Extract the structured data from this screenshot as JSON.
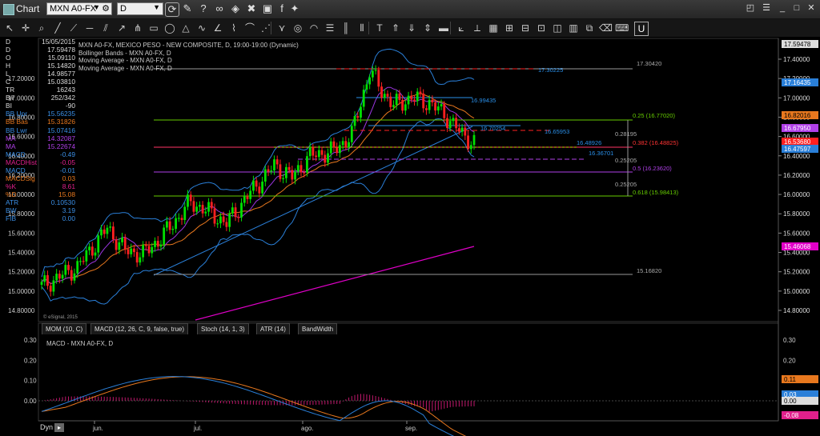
{
  "window": {
    "title": "Chart",
    "symbol": "MXN A0-FX",
    "interval": "D"
  },
  "colors": {
    "up": "#00e000",
    "down": "#ff2020",
    "bb": "#2a7fd8",
    "ma_orange": "#e8781e",
    "ma_purple": "#9b35e0",
    "ma_magenta": "#e000c8",
    "fib": "#66cc00"
  },
  "data_window": [
    {
      "label": "D",
      "value": "15/05/2015",
      "color": "#dddddd"
    },
    {
      "label": "D",
      "value": "17.59478",
      "color": "#dddddd"
    },
    {
      "label": "O",
      "value": "15.09110",
      "color": "#dddddd"
    },
    {
      "label": "H",
      "value": "15.14820",
      "color": "#dddddd"
    },
    {
      "label": "L",
      "value": "14.98577",
      "color": "#dddddd"
    },
    {
      "label": "C",
      "value": "15.03810",
      "color": "#dddddd"
    },
    {
      "label": "TR",
      "value": "16243",
      "color": "#dddddd"
    },
    {
      "label": "B#",
      "value": "252/342",
      "color": "#dddddd"
    },
    {
      "label": "BI",
      "value": "-90",
      "color": "#dddddd"
    },
    {
      "label": "BB Upr",
      "value": "15.56235",
      "color": "#3b8fe6"
    },
    {
      "label": "BB Bas",
      "value": "15.31826",
      "color": "#e8781e"
    },
    {
      "label": "BB Lwr",
      "value": "15.07416",
      "color": "#3b8fe6"
    },
    {
      "label": "MA",
      "value": "14.32087",
      "color": "#b040e8"
    },
    {
      "label": "MA",
      "value": "15.22674",
      "color": "#b040e8"
    },
    {
      "label": "MACD",
      "value": "-0.49",
      "color": "#3b8fe6"
    },
    {
      "label": "MACDHist",
      "value": "-0.05",
      "color": "#e0208c"
    },
    {
      "label": "MACD",
      "value": "-0.01",
      "color": "#3b8fe6"
    },
    {
      "label": "MACDSig",
      "value": "0.03",
      "color": "#e8781e"
    },
    {
      "label": "%K",
      "value": "8.61",
      "color": "#e0208c"
    },
    {
      "label": "%D",
      "value": "15.08",
      "color": "#e8781e"
    },
    {
      "label": "ATR",
      "value": "0.10530",
      "color": "#3b8fe6"
    },
    {
      "label": "BW",
      "value": "3.19",
      "color": "#3b8fe6"
    },
    {
      "label": "FIB",
      "value": "0.00",
      "color": "#3b8fe6"
    }
  ],
  "legend_lines": [
    "MXN A0-FX, MEXICO PESO - NEW COMPOSITE, D, 19:00-19:00 (Dynamic)",
    "Bollinger Bands - MXN A0-FX, D",
    "Moving Average - MXN A0-FX, D",
    "Moving Average - MXN A0-FX, D"
  ],
  "price_axis": {
    "ticks": [
      "17.40000",
      "17.20000",
      "17.00000",
      "16.80000",
      "16.60000",
      "16.40000",
      "16.20000",
      "16.00000",
      "15.80000",
      "15.60000",
      "15.40000",
      "15.20000",
      "15.00000",
      "14.80000"
    ],
    "left_ticks": [
      "17.20000",
      "17.00000",
      "16.80000",
      "16.60000",
      "16.40000",
      "16.20000",
      "16.00000",
      "15.80000",
      "15.60000",
      "15.40000",
      "15.20000",
      "15.00000",
      "14.80000"
    ]
  },
  "price_labels": [
    {
      "text": "17.59478",
      "bg": "#dddddd",
      "fg": "#000000"
    },
    {
      "text": "17.16435",
      "bg": "#2a7fd8",
      "fg": "#ffffff"
    },
    {
      "text": "16.82016",
      "bg": "#e8781e",
      "fg": "#000000"
    },
    {
      "text": "16.67950",
      "bg": "#b040e8",
      "fg": "#ffffff"
    },
    {
      "text": "16.53680",
      "bg": "#ff2020",
      "fg": "#ffffff"
    },
    {
      "text": "16.47597",
      "bg": "#2a7fd8",
      "fg": "#ffffff"
    },
    {
      "text": "15.46068",
      "bg": "#e000c8",
      "fg": "#ffffff"
    }
  ],
  "chart_annotations": [
    {
      "text": "17.30420",
      "color": "#aaaaaa"
    },
    {
      "text": "17.30225",
      "color": "#2a8fe8"
    },
    {
      "text": "16.99435",
      "color": "#2a8fe8"
    },
    {
      "text": "16.70254",
      "color": "#2a8fe8"
    },
    {
      "text": "16.65953",
      "color": "#2a8fe8"
    },
    {
      "text": "16.48926",
      "color": "#2a8fe8"
    },
    {
      "text": "16.36701",
      "color": "#2a8fe8"
    },
    {
      "text": "0.25 (16.77020)",
      "color": "#66cc00"
    },
    {
      "text": "0.28195",
      "color": "#aaaaaa"
    },
    {
      "text": "0.382 (16.48825)",
      "color": "#ff3333"
    },
    {
      "text": "0.25205",
      "color": "#aaaaaa"
    },
    {
      "text": "0.5 (16.23620)",
      "color": "#b040e8"
    },
    {
      "text": "0.25205",
      "color": "#aaaaaa"
    },
    {
      "text": "0.618 (15.98413)",
      "color": "#66cc00"
    },
    {
      "text": "15.16820",
      "color": "#aaaaaa"
    }
  ],
  "watermark": "© eSignal, 2015",
  "indicator_tabs": [
    "MOM (10, C)",
    "MACD (12, 26, C, 9, false, true)",
    "Stoch (14, 1, 3)",
    "ATR (14)",
    "BandWidth"
  ],
  "macd_pane": {
    "title": "MACD - MXN A0-FX, D",
    "ticks": [
      "0.30",
      "0.20",
      "0.10",
      "0.00"
    ],
    "labels": [
      {
        "text": "0.11",
        "bg": "#e8781e",
        "fg": "#000000"
      },
      {
        "text": "0.03",
        "bg": "#2a7fd8",
        "fg": "#ffffff"
      },
      {
        "text": "0.00",
        "bg": "#dddddd",
        "fg": "#000000"
      },
      {
        "text": "-0.08",
        "bg": "#e0208c",
        "fg": "#ffffff"
      }
    ]
  },
  "time_axis": {
    "labels": [
      "jun.",
      "jul.",
      "ago.",
      "sep."
    ],
    "mode": "Dyn"
  }
}
